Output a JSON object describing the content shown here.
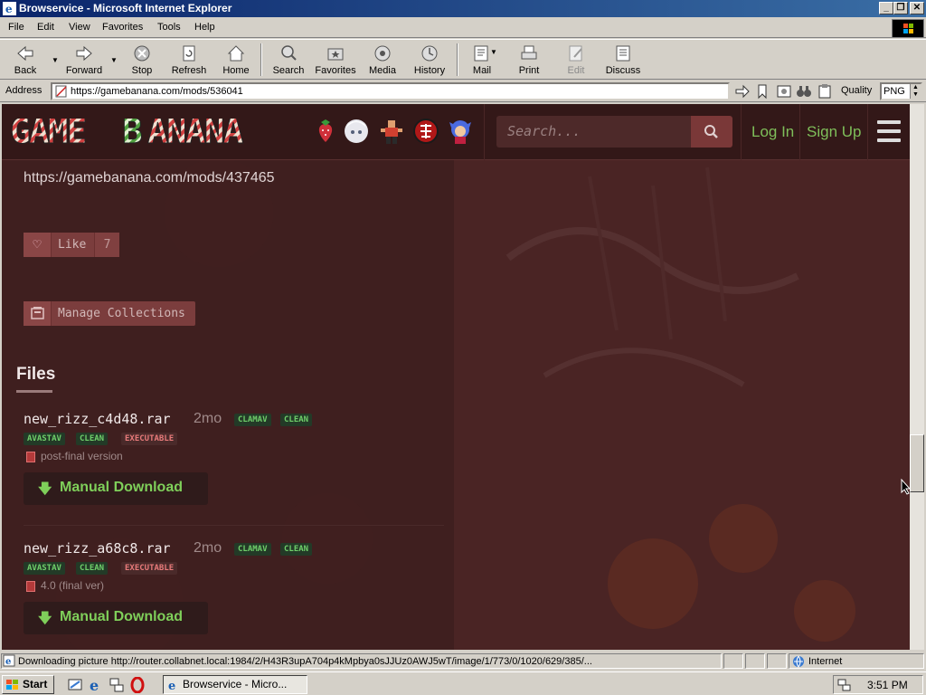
{
  "window": {
    "title": "Browservice - Microsoft Internet Explorer",
    "minimize": "_",
    "restore": "❐",
    "close": "✕"
  },
  "menu": [
    "File",
    "Edit",
    "View",
    "Favorites",
    "Tools",
    "Help"
  ],
  "toolbar": {
    "back": "Back",
    "forward": "Forward",
    "stop": "Stop",
    "refresh": "Refresh",
    "home": "Home",
    "search": "Search",
    "favorites": "Favorites",
    "media": "Media",
    "history": "History",
    "mail": "Mail",
    "print": "Print",
    "edit": "Edit",
    "discuss": "Discuss"
  },
  "address": {
    "label": "Address",
    "url": "https://gamebanana.com/mods/536041",
    "quality_label": "Quality",
    "quality_value": "PNG"
  },
  "site": {
    "logo_text": "GAMEBANANA",
    "search_placeholder": "Search...",
    "login": "Log In",
    "signup": "Sign Up",
    "game_icons": [
      "strawberry-game-icon",
      "anime-character-game-icon",
      "fighter-game-icon",
      "red-emblem-game-icon",
      "fnf-character-game-icon"
    ]
  },
  "content": {
    "mod_url": "https://gamebanana.com/mods/437465",
    "like_label": "Like",
    "like_count": "7",
    "collections_label": "Manage Collections",
    "files_heading": "Files",
    "files": [
      {
        "name": "new_rizz_c4d48.rar",
        "age": "2mo",
        "scan1": [
          "CLAMAV",
          "CLEAN"
        ],
        "scan2": [
          "AVASTAV",
          "CLEAN",
          "EXECUTABLE"
        ],
        "description": "post-final version",
        "download_label": "Manual Download"
      },
      {
        "name": "new_rizz_a68c8.rar",
        "age": "2mo",
        "scan1": [
          "CLAMAV",
          "CLEAN"
        ],
        "scan2": [
          "AVASTAV",
          "CLEAN",
          "EXECUTABLE"
        ],
        "description": "4.0 (final ver)",
        "download_label": "Manual Download"
      }
    ]
  },
  "status": {
    "text": "Downloading picture http://router.collabnet.local:1984/2/H43R3upA704p4kMpbya0sJJUz0AWJ5wT/image/1/773/0/1020/629/385/...",
    "zone": "Internet"
  },
  "taskbar": {
    "start": "Start",
    "task_label": "Browservice - Micro...",
    "clock": "3:51 PM"
  },
  "colors": {
    "accent_green": "#7fcf5a",
    "site_header": "#331818",
    "title_bar": "#0a246a"
  }
}
